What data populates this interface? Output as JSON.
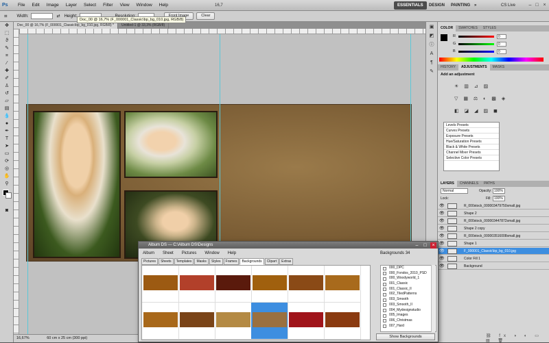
{
  "app": {
    "logo": "Ps"
  },
  "menu": {
    "items": [
      "File",
      "Edit",
      "Image",
      "Layer",
      "Select",
      "Filter",
      "View",
      "Window",
      "Help"
    ],
    "zoom": "16,7"
  },
  "workspaces": {
    "essentials": "ESSENTIALS",
    "design": "DESIGN",
    "painting": "PAINTING",
    "more": "»",
    "cslive": "CS Live"
  },
  "options": {
    "width_label": "Width:",
    "height_label": "Height:",
    "resolution_label": "Resolution:",
    "front_image": "Front Image",
    "clear": "Clear"
  },
  "tooltip": "Doc_00 @ 16,7% (F_000001_Classic\\bp_bg_010.jpg, RGB/8)",
  "doc_tabs": [
    "Doc_00 @ 16,7% (F_000001_Classic\\bp_bg_010.jpg, RGB/8) *",
    "Untitled-1 @ 33,3% (RGB/8)"
  ],
  "status": {
    "zoom": "16,67%",
    "doc_size": "60 cm x 25 cm (300 ppi)"
  },
  "color_panel": {
    "tabs": [
      "COLOR",
      "SWATCHES",
      "STYLES"
    ],
    "r": "0",
    "g": "0",
    "b": "0",
    "r_label": "R",
    "g_label": "G",
    "b_label": "B"
  },
  "adj_panel": {
    "tabs": [
      "HISTORY",
      "ADJUSTMENTS",
      "MASKS"
    ],
    "heading": "Add an adjustment",
    "presets": [
      "Levels Presets",
      "Curves Presets",
      "Exposure Presets",
      "Hue/Saturation Presets",
      "Black & White Presets",
      "Channel Mixer Presets",
      "Selective Color Presets"
    ]
  },
  "layers_panel": {
    "tabs": [
      "LAYERS",
      "CHANNELS",
      "PATHS"
    ],
    "blend": "Normal",
    "opacity_label": "Opacity:",
    "opacity": "100%",
    "lock_label": "Lock:",
    "fill_label": "Fill:",
    "fill": "100%",
    "layers": [
      {
        "name": "R_000stock_000003479750small.jpg",
        "selected": false
      },
      {
        "name": "Shape 2",
        "selected": false
      },
      {
        "name": "R_000stock_000003447872small.jpg",
        "selected": false
      },
      {
        "name": "Shape 2 copy",
        "selected": false
      },
      {
        "name": "R_000stock_000003516008small.jpg",
        "selected": false
      },
      {
        "name": "Shape 1",
        "selected": false
      },
      {
        "name": "F_000001_Classic\\bp_bg_010.jpg",
        "selected": true
      },
      {
        "name": "Color Fill 1",
        "selected": false
      },
      {
        "name": "Background",
        "selected": false
      }
    ]
  },
  "album": {
    "title": "Album DS — C:\\Album DS\\Designs",
    "menu": [
      "Album",
      "Sheet",
      "Pictures",
      "Window",
      "Help"
    ],
    "tabs": [
      "Pictures",
      "Sheets",
      "Templates",
      "Masks",
      "Styles",
      "Frames",
      "Backgrounds",
      "Clipart",
      "Extras"
    ],
    "count_label": "Backgrounds 34",
    "list": [
      "000_DPC",
      "000_Fondos_2010_PSD",
      "000_Woodyworld_1",
      "001_Classic",
      "001_Classic_II",
      "002_TiledPatterns",
      "003_Smooth",
      "003_Smooth_II",
      "004_Mydesignstudio",
      "005_Images",
      "006_Christmas",
      "007_Hard"
    ],
    "show_button": "Show Backgrounds",
    "tile_colors": [
      "#9c5a12",
      "#b2402a",
      "#5a1a0c",
      "#a0600e",
      "#8a4a16",
      "#a86a1c",
      "#a8681a",
      "#7a4418",
      "#b48a44",
      "#9a7040",
      "#a0141a",
      "#8a3a10"
    ]
  }
}
